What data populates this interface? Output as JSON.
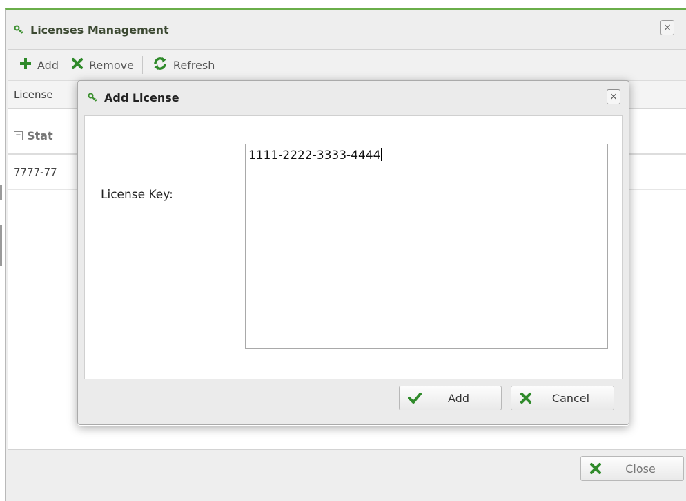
{
  "main_window": {
    "title": "Licenses Management",
    "close_glyph": "×",
    "toolbar": {
      "add_label": "Add",
      "remove_label": "Remove",
      "refresh_label": "Refresh"
    },
    "grid": {
      "column_header": "License",
      "group_label": "Stat",
      "rows": [
        "7777-77"
      ]
    },
    "footer": {
      "close_label": "Close"
    }
  },
  "dialog": {
    "title": "Add License",
    "close_glyph": "×",
    "field_label": "License Key:",
    "field_value": "1111-2222-3333-4444",
    "add_label": "Add",
    "cancel_label": "Cancel"
  },
  "icons": {
    "key": "key-icon",
    "add": "plus-icon",
    "remove": "x-icon",
    "refresh": "refresh-icon",
    "check": "check-icon"
  },
  "colors": {
    "accent_green": "#2f8a2a",
    "title_bar_border": "#6aae4a"
  }
}
